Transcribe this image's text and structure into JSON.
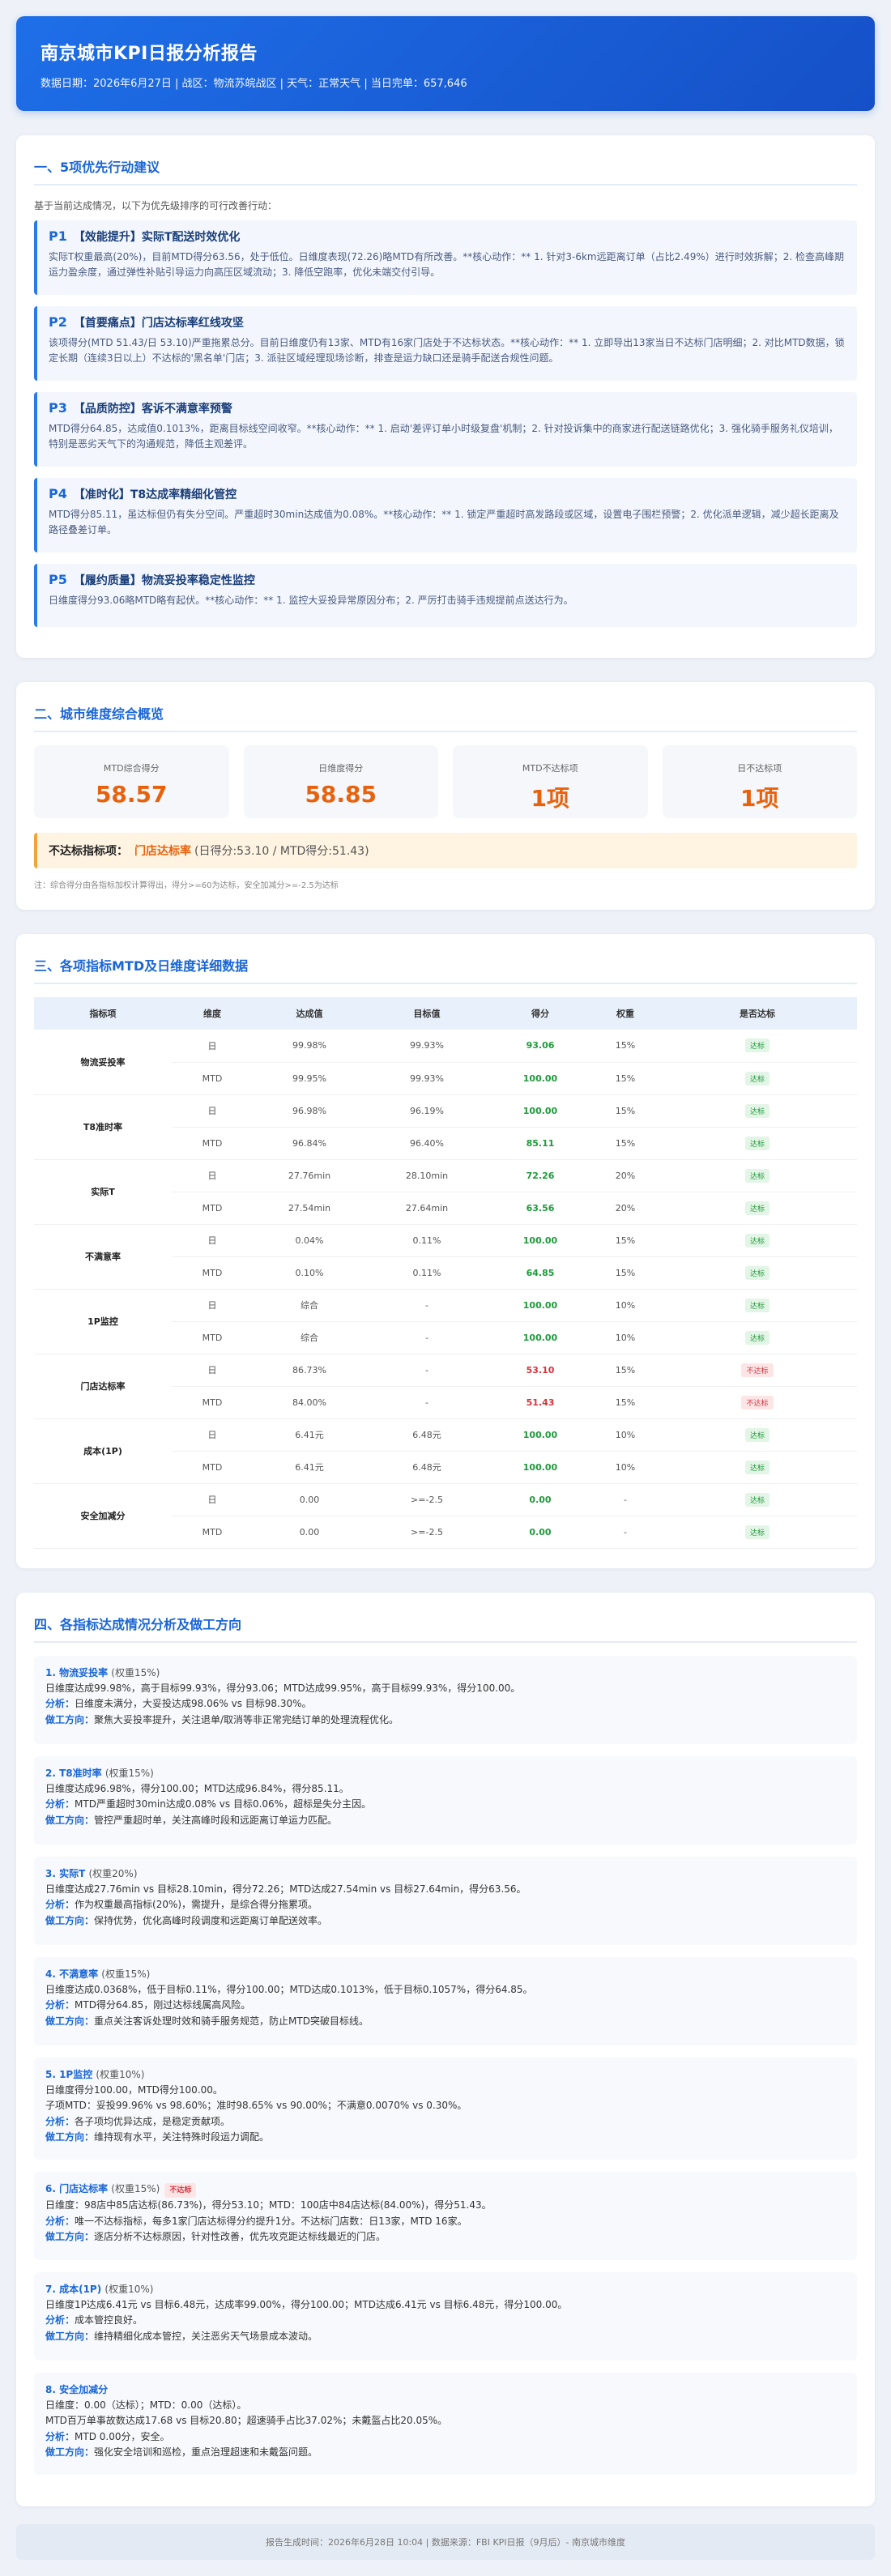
{
  "header": {
    "title": "南京城市KPI日报分析报告",
    "meta": "数据日期：2026年6月27日 | 战区：物流苏皖战区 | 天气：正常天气 | 当日完单：657,646"
  },
  "actions": {
    "title": "一、5项优先行动建议",
    "intro": "基于当前达成情况，以下为优先级排序的可行改善行动：",
    "items": [
      {
        "p": "P1",
        "title": "【效能提升】实际T配送时效优化",
        "body": "实际T权重最高(20%)，目前MTD得分63.56，处于低位。日维度表现(72.26)略MTD有所改善。**核心动作：** 1. 针对3-6km远距离订单（占比2.49%）进行时效拆解；2. 检查高峰期运力盈余度，通过弹性补贴引导运力向高压区域流动；3. 降低空跑率，优化未端交付引导。"
      },
      {
        "p": "P2",
        "title": "【首要痛点】门店达标率红线攻坚",
        "body": "该项得分(MTD 51.43/日 53.10)严重拖累总分。目前日维度仍有13家、MTD有16家门店处于不达标状态。**核心动作：** 1. 立即导出13家当日不达标门店明细；2. 对比MTD数据，锁定长期（连续3日以上）不达标的'黑名单'门店；3. 派驻区域经理现场诊断，排查是运力缺口还是骑手配送合规性问题。"
      },
      {
        "p": "P3",
        "title": "【品质防控】客诉不满意率预警",
        "body": "MTD得分64.85，达成值0.1013%，距离目标线空间收窄。**核心动作：** 1. 启动'差评订单小时级复盘'机制；2. 针对投诉集中的商家进行配送链路优化；3. 强化骑手服务礼仪培训，特别是恶劣天气下的沟通规范，降低主观差评。"
      },
      {
        "p": "P4",
        "title": "【准时化】T8达成率精细化管控",
        "body": "MTD得分85.11，虽达标但仍有失分空间。严重超时30min达成值为0.08%。**核心动作：** 1. 锁定严重超时高发路段或区域，设置电子围栏预警；2. 优化派单逻辑，减少超长距离及路径叠差订单。"
      },
      {
        "p": "P5",
        "title": "【履约质量】物流妥投率稳定性监控",
        "body": "日维度得分93.06略MTD略有起伏。**核心动作：** 1. 监控大妥投异常原因分布；2. 严厉打击骑手违规提前点送达行为。"
      }
    ]
  },
  "overview": {
    "title": "二、城市维度综合概览",
    "kpis": [
      {
        "label": "MTD综合得分",
        "value": "58.57"
      },
      {
        "label": "日维度得分",
        "value": "58.85"
      },
      {
        "label": "MTD不达标项",
        "value": "1项"
      },
      {
        "label": "日不达标项",
        "value": "1项"
      }
    ],
    "notice_key": "不达标指标项：",
    "notice_val": "门店达标率",
    "notice_detail": "(日得分:53.10 / MTD得分:51.43)",
    "note": "注：综合得分由各指标加权计算得出，得分>=60为达标，安全加减分>=-2.5为达标"
  },
  "detail": {
    "title": "三、各项指标MTD及日维度详细数据",
    "headers": [
      "指标项",
      "维度",
      "达成值",
      "目标值",
      "得分",
      "权重",
      "是否达标"
    ],
    "rows": [
      {
        "ind": "物流妥投率",
        "r": [
          [
            "日",
            "99.98%",
            "99.93%",
            "93.06",
            "15%",
            "达标"
          ],
          [
            "MTD",
            "99.95%",
            "99.93%",
            "100.00",
            "15%",
            "达标"
          ]
        ]
      },
      {
        "ind": "T8准时率",
        "r": [
          [
            "日",
            "96.98%",
            "96.19%",
            "100.00",
            "15%",
            "达标"
          ],
          [
            "MTD",
            "96.84%",
            "96.40%",
            "85.11",
            "15%",
            "达标"
          ]
        ]
      },
      {
        "ind": "实际T",
        "r": [
          [
            "日",
            "27.76min",
            "28.10min",
            "72.26",
            "20%",
            "达标"
          ],
          [
            "MTD",
            "27.54min",
            "27.64min",
            "63.56",
            "20%",
            "达标"
          ]
        ]
      },
      {
        "ind": "不满意率",
        "r": [
          [
            "日",
            "0.04%",
            "0.11%",
            "100.00",
            "15%",
            "达标"
          ],
          [
            "MTD",
            "0.10%",
            "0.11%",
            "64.85",
            "15%",
            "达标"
          ]
        ]
      },
      {
        "ind": "1P监控",
        "r": [
          [
            "日",
            "综合",
            "-",
            "100.00",
            "10%",
            "达标"
          ],
          [
            "MTD",
            "综合",
            "-",
            "100.00",
            "10%",
            "达标"
          ]
        ]
      },
      {
        "ind": "门店达标率",
        "r": [
          [
            "日",
            "86.73%",
            "-",
            "53.10",
            "15%",
            "不达标"
          ],
          [
            "MTD",
            "84.00%",
            "-",
            "51.43",
            "15%",
            "不达标"
          ]
        ]
      },
      {
        "ind": "成本(1P)",
        "r": [
          [
            "日",
            "6.41元",
            "6.48元",
            "100.00",
            "10%",
            "达标"
          ],
          [
            "MTD",
            "6.41元",
            "6.48元",
            "100.00",
            "10%",
            "达标"
          ]
        ]
      },
      {
        "ind": "安全加减分",
        "r": [
          [
            "日",
            "0.00",
            ">=-2.5",
            "0.00",
            "-",
            "达标"
          ],
          [
            "MTD",
            "0.00",
            ">=-2.5",
            "0.00",
            "-",
            "达标"
          ]
        ]
      }
    ]
  },
  "analysis": {
    "title": "四、各指标达成情况分析及做工方向",
    "analysis_label": "分析：",
    "direction_label": "做工方向：",
    "items": [
      {
        "head": "1. 物流妥投率",
        "weight": "(权重15%)",
        "lines": [
          "日维度达成99.98%，高于目标99.93%，得分93.06；MTD达成99.95%，高于目标99.93%，得分100.00。"
        ],
        "analysis": "日维度未满分，大妥投达成98.06% vs 目标98.30%。",
        "direction": "聚焦大妥投率提升，关注退单/取消等非正常完结订单的处理流程优化。"
      },
      {
        "head": "2. T8准时率",
        "weight": "(权重15%)",
        "lines": [
          "日维度达成96.98%，得分100.00；MTD达成96.84%，得分85.11。"
        ],
        "analysis": "MTD严重超时30min达成0.08% vs 目标0.06%，超标是失分主因。",
        "direction": "管控严重超时单，关注高峰时段和远距离订单运力匹配。"
      },
      {
        "head": "3. 实际T",
        "weight": "(权重20%)",
        "lines": [
          "日维度达成27.76min vs 目标28.10min，得分72.26；MTD达成27.54min vs 目标27.64min，得分63.56。"
        ],
        "analysis": "作为权重最高指标(20%)，需提升，是综合得分拖累项。",
        "direction": "保持优势，优化高峰时段调度和远距离订单配送效率。"
      },
      {
        "head": "4. 不满意率",
        "weight": "(权重15%)",
        "lines": [
          "日维度达成0.0368%，低于目标0.11%，得分100.00；MTD达成0.1013%，低于目标0.1057%，得分64.85。"
        ],
        "analysis": "MTD得分64.85，刚过达标线属高风险。",
        "direction": "重点关注客诉处理时效和骑手服务规范，防止MTD突破目标线。"
      },
      {
        "head": "5. 1P监控",
        "weight": "(权重10%)",
        "lines": [
          "日维度得分100.00，MTD得分100.00。",
          "子项MTD：妥投99.96% vs 98.60%；准时98.65% vs 90.00%；不满意0.0070% vs 0.30%。"
        ],
        "analysis": "各子项均优异达成，是稳定贡献项。",
        "direction": "维持现有水平，关注特殊时段运力调配。"
      },
      {
        "head": "6. 门店达标率",
        "weight": "(权重15%)",
        "tag": "不达标",
        "lines": [
          "日维度：98店中85店达标(86.73%)，得分53.10；MTD：100店中84店达标(84.00%)，得分51.43。"
        ],
        "analysis": "唯一不达标指标，每多1家门店达标得分约提升1分。不达标门店数：日13家，MTD 16家。",
        "direction": "逐店分析不达标原因，针对性改善，优先攻克距达标线最近的门店。"
      },
      {
        "head": "7. 成本(1P)",
        "weight": "(权重10%)",
        "lines": [
          "日维度1P达成6.41元 vs 目标6.48元，达成率99.00%，得分100.00；MTD达成6.41元 vs 目标6.48元，得分100.00。"
        ],
        "analysis": "成本管控良好。",
        "direction": "维持精细化成本管控，关注恶劣天气场景成本波动。"
      },
      {
        "head": "8. 安全加减分",
        "weight": "",
        "lines": [
          "日维度：0.00（达标）；MTD：0.00（达标）。",
          "MTD百万单事故数达成17.68 vs 目标20.80；超速骑手占比37.02%；未戴盔占比20.05%。"
        ],
        "analysis": "MTD 0.00分，安全。",
        "direction": "强化安全培训和巡检，重点治理超速和未戴盔问题。"
      }
    ]
  },
  "footer": "报告生成时间：2026年6月28日 10:04 | 数据来源：FBI KPI日报（9月后）- 南京城市维度"
}
